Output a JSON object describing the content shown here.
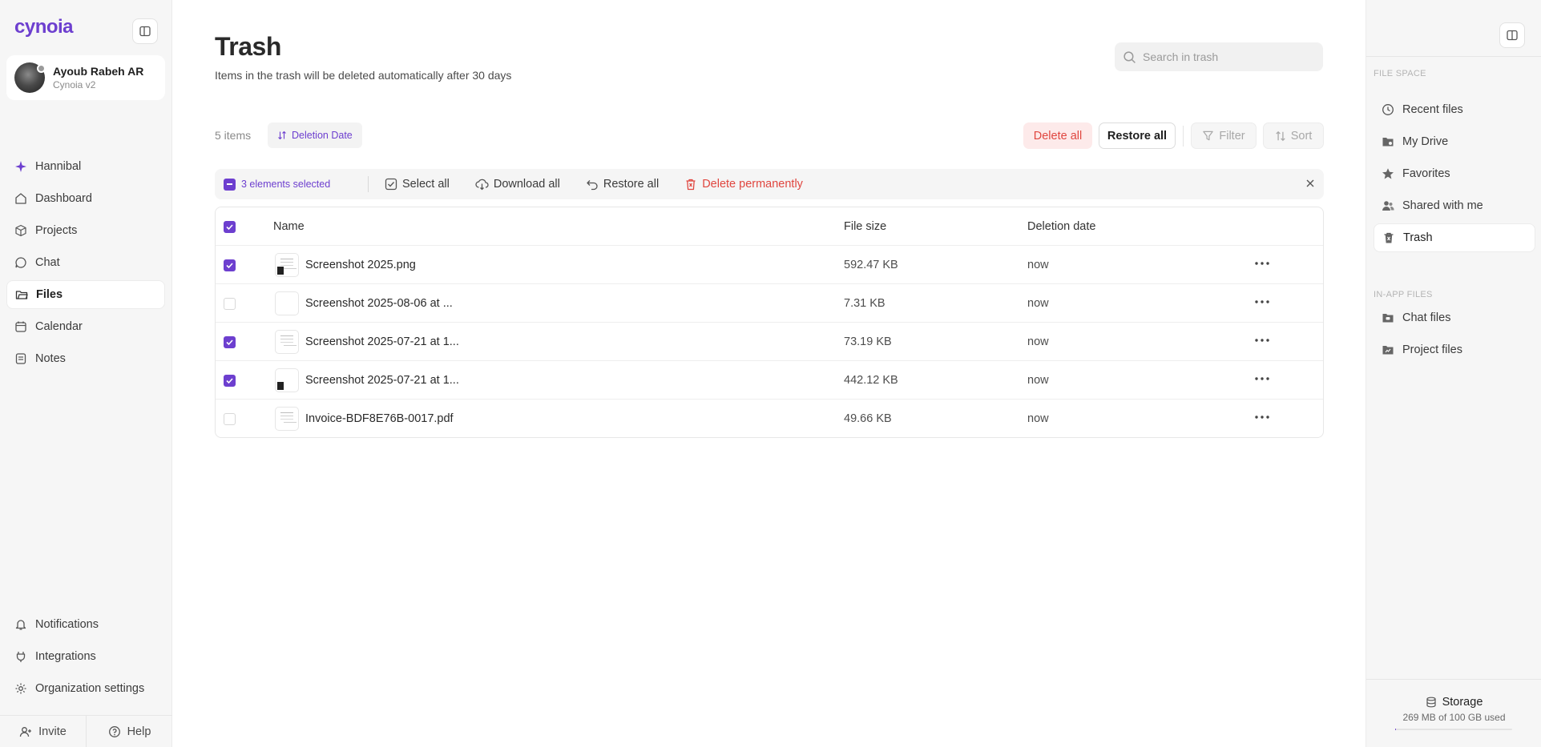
{
  "app": {
    "logo": "cynoia"
  },
  "user": {
    "name": "Ayoub Rabeh AR",
    "org": "Cynoia v2"
  },
  "nav": [
    {
      "label": "Hannibal",
      "icon": "sparkle-icon",
      "active": false
    },
    {
      "label": "Dashboard",
      "icon": "home-icon",
      "active": false
    },
    {
      "label": "Projects",
      "icon": "cube-icon",
      "active": false
    },
    {
      "label": "Chat",
      "icon": "chat-icon",
      "active": false
    },
    {
      "label": "Files",
      "icon": "folder-icon",
      "active": true
    },
    {
      "label": "Calendar",
      "icon": "calendar-icon",
      "active": false
    },
    {
      "label": "Notes",
      "icon": "notes-icon",
      "active": false
    }
  ],
  "nav_bottom": [
    {
      "label": "Notifications",
      "icon": "bell-icon"
    },
    {
      "label": "Integrations",
      "icon": "plug-icon"
    },
    {
      "label": "Organization settings",
      "icon": "gear-icon"
    }
  ],
  "footer": {
    "invite": "Invite",
    "help": "Help"
  },
  "page": {
    "title": "Trash",
    "subtitle": "Items in the trash will be deleted automatically after 30 days",
    "search_placeholder": "Search in trash",
    "item_count": "5 items",
    "sort_chip": "Deletion Date",
    "delete_all": "Delete all",
    "restore_all": "Restore all",
    "filter": "Filter",
    "sort": "Sort"
  },
  "selection_bar": {
    "count": "3 elements selected",
    "select_all": "Select all",
    "download_all": "Download all",
    "restore_all": "Restore all",
    "delete_permanently": "Delete permanently"
  },
  "table": {
    "columns": [
      "Name",
      "File size",
      "Deletion date"
    ],
    "rows": [
      {
        "name": "Screenshot 2025.png",
        "size": "592.47 KB",
        "date": "now",
        "checked": true,
        "thumb": "dark"
      },
      {
        "name": "Screenshot 2025-08-06 at ...",
        "size": "7.31 KB",
        "date": "now",
        "checked": false,
        "thumb": "blank"
      },
      {
        "name": "Screenshot 2025-07-21 at 1...",
        "size": "73.19 KB",
        "date": "now",
        "checked": true,
        "thumb": "lines"
      },
      {
        "name": "Screenshot 2025-07-21 at 1...",
        "size": "442.12 KB",
        "date": "now",
        "checked": true,
        "thumb": "dark"
      },
      {
        "name": "Invoice-BDF8E76B-0017.pdf",
        "size": "49.66 KB",
        "date": "now",
        "checked": false,
        "thumb": "lines"
      }
    ]
  },
  "right_sidebar": {
    "file_space_title": "FILE SPACE",
    "file_space": [
      {
        "label": "Recent files",
        "icon": "clock-icon",
        "active": false
      },
      {
        "label": "My Drive",
        "icon": "drive-folder-icon",
        "active": false
      },
      {
        "label": "Favorites",
        "icon": "star-icon",
        "active": false
      },
      {
        "label": "Shared with me",
        "icon": "people-icon",
        "active": false
      },
      {
        "label": "Trash",
        "icon": "trash-icon",
        "active": true
      }
    ],
    "in_app_title": "IN-APP FILES",
    "in_app": [
      {
        "label": "Chat files",
        "icon": "chat-folder-icon"
      },
      {
        "label": "Project files",
        "icon": "project-folder-icon"
      }
    ],
    "storage_title": "Storage",
    "storage_used": "269 MB of 100 GB used",
    "storage_fraction": 0.0027
  },
  "colors": {
    "accent": "#6d3fcf",
    "danger": "#e0463f"
  }
}
